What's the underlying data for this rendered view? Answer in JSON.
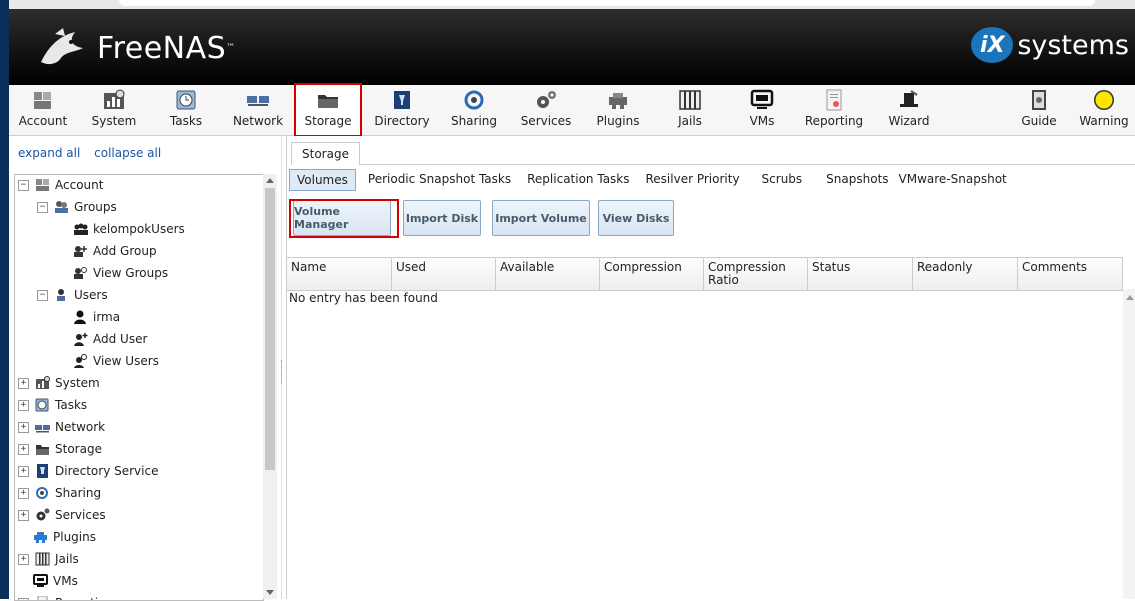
{
  "header": {
    "brand": "FreeNAS",
    "brand_tm": "™",
    "vendor_badge": "iX",
    "vendor_text": "systems"
  },
  "toolbar": [
    {
      "label": "Account",
      "icon": "account-icon"
    },
    {
      "label": "System",
      "icon": "system-icon"
    },
    {
      "label": "Tasks",
      "icon": "tasks-icon"
    },
    {
      "label": "Network",
      "icon": "network-icon"
    },
    {
      "label": "Storage",
      "icon": "storage-icon",
      "active": true
    },
    {
      "label": "Directory",
      "icon": "directory-icon"
    },
    {
      "label": "Sharing",
      "icon": "sharing-icon"
    },
    {
      "label": "Services",
      "icon": "services-icon"
    },
    {
      "label": "Plugins",
      "icon": "plugins-icon"
    },
    {
      "label": "Jails",
      "icon": "jails-icon"
    },
    {
      "label": "VMs",
      "icon": "vms-icon"
    },
    {
      "label": "Reporting",
      "icon": "reporting-icon"
    },
    {
      "label": "Wizard",
      "icon": "wizard-icon"
    },
    {
      "label": "Guide",
      "icon": "guide-icon"
    },
    {
      "label": "Warning",
      "icon": "warning-icon"
    }
  ],
  "leftpane": {
    "expand_all": "expand all",
    "collapse_all": "collapse all",
    "tree": [
      {
        "label": "Account",
        "toggle": "−",
        "icon": "account-icon"
      },
      {
        "label": "Groups",
        "toggle": "−",
        "icon": "groups-icon"
      },
      {
        "label": "kelompokUsers",
        "icon": "group-icon"
      },
      {
        "label": "Add Group",
        "icon": "add-group-icon"
      },
      {
        "label": "View Groups",
        "icon": "view-groups-icon"
      },
      {
        "label": "Users",
        "toggle": "−",
        "icon": "users-icon"
      },
      {
        "label": "irma",
        "icon": "user-icon"
      },
      {
        "label": "Add User",
        "icon": "add-user-icon"
      },
      {
        "label": "View Users",
        "icon": "view-users-icon"
      },
      {
        "label": "System",
        "toggle": "+",
        "icon": "system-icon"
      },
      {
        "label": "Tasks",
        "toggle": "+",
        "icon": "tasks-icon"
      },
      {
        "label": "Network",
        "toggle": "+",
        "icon": "network-icon"
      },
      {
        "label": "Storage",
        "toggle": "+",
        "icon": "storage-icon"
      },
      {
        "label": "Directory Service",
        "toggle": "+",
        "icon": "directory-icon"
      },
      {
        "label": "Sharing",
        "toggle": "+",
        "icon": "sharing-icon"
      },
      {
        "label": "Services",
        "toggle": "+",
        "icon": "services-icon"
      },
      {
        "label": "Plugins",
        "icon": "plugins-icon"
      },
      {
        "label": "Jails",
        "toggle": "+",
        "icon": "jails-icon"
      },
      {
        "label": "VMs",
        "icon": "vms-icon"
      },
      {
        "label": "Reporting",
        "toggle": "+",
        "icon": "reporting-icon"
      }
    ]
  },
  "main": {
    "tab": "Storage",
    "subtabs": [
      "Volumes",
      "Periodic Snapshot Tasks",
      "Replication Tasks",
      "Resilver Priority",
      "Scrubs",
      "Snapshots",
      "VMware-Snapshot"
    ],
    "buttons": [
      "Volume Manager",
      "Import Disk",
      "Import Volume",
      "View Disks"
    ],
    "columns": [
      "Name",
      "Used",
      "Available",
      "Compression",
      "Compression Ratio",
      "Status",
      "Readonly",
      "Comments"
    ],
    "empty_message": "No entry has been found"
  }
}
